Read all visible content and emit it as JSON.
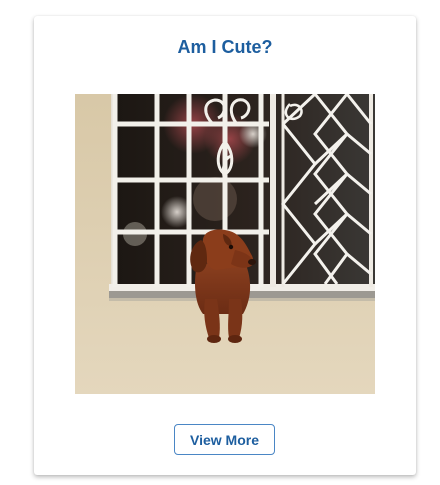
{
  "card": {
    "title": "Am I Cute?",
    "image_subject": "dachshund dog leaning out of a window with white iron bars",
    "button_label": "View More"
  },
  "colors": {
    "title": "#1d5e9f",
    "button_border": "#4a86c5",
    "button_text": "#1d5e9f"
  }
}
